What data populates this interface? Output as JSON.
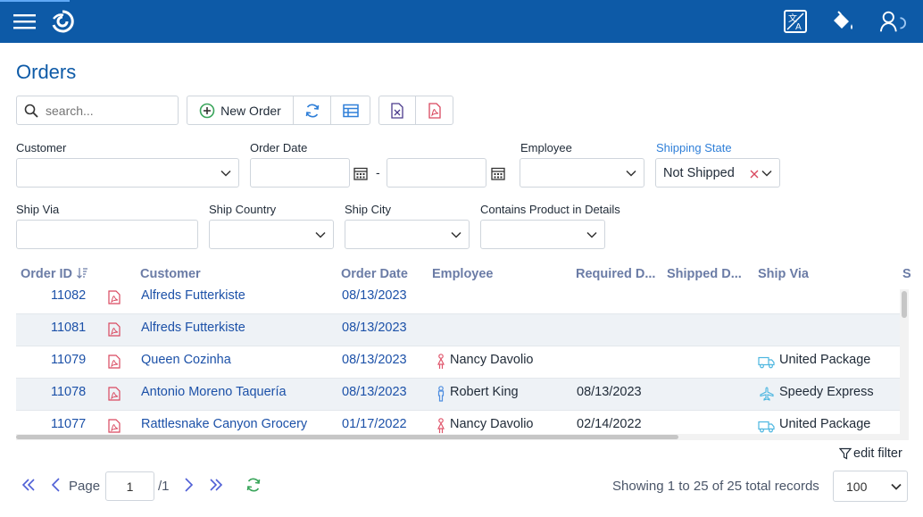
{
  "page": {
    "title": "Orders"
  },
  "toolbar": {
    "search_placeholder": "search...",
    "new_order_label": "New Order"
  },
  "filters": {
    "customer": {
      "label": "Customer",
      "value": ""
    },
    "order_date": {
      "label": "Order Date",
      "separator": "-"
    },
    "employee": {
      "label": "Employee",
      "value": ""
    },
    "shipping_state": {
      "label": "Shipping State",
      "value": "Not Shipped"
    },
    "ship_via": {
      "label": "Ship Via",
      "value": ""
    },
    "ship_country": {
      "label": "Ship Country",
      "value": ""
    },
    "ship_city": {
      "label": "Ship City",
      "value": ""
    },
    "contains_product": {
      "label": "Contains Product in Details",
      "value": ""
    }
  },
  "grid": {
    "columns": [
      "Order ID",
      "Customer",
      "Order Date",
      "Employee",
      "Required D...",
      "Shipped D...",
      "Ship Via",
      "S"
    ],
    "rows": [
      {
        "order_id": "11082",
        "customer": "Alfreds Futterkiste",
        "order_date": "08/13/2023",
        "employee": "",
        "employee_gender": "",
        "required": "",
        "shipped": "",
        "ship_via": "",
        "ship_icon": ""
      },
      {
        "order_id": "11081",
        "customer": "Alfreds Futterkiste",
        "order_date": "08/13/2023",
        "employee": "",
        "employee_gender": "",
        "required": "",
        "shipped": "",
        "ship_via": "",
        "ship_icon": ""
      },
      {
        "order_id": "11079",
        "customer": "Queen Cozinha",
        "order_date": "08/13/2023",
        "employee": "Nancy Davolio",
        "employee_gender": "female",
        "required": "",
        "shipped": "",
        "ship_via": "United Package",
        "ship_icon": "truck"
      },
      {
        "order_id": "11078",
        "customer": "Antonio Moreno Taquería",
        "order_date": "08/13/2023",
        "employee": "Robert King",
        "employee_gender": "male",
        "required": "08/13/2023",
        "shipped": "",
        "ship_via": "Speedy Express",
        "ship_icon": "plane"
      },
      {
        "order_id": "11077",
        "customer": "Rattlesnake Canyon Grocery",
        "order_date": "01/17/2022",
        "employee": "Nancy Davolio",
        "employee_gender": "female",
        "required": "02/14/2022",
        "shipped": "",
        "ship_via": "United Package",
        "ship_icon": "truck"
      }
    ]
  },
  "footer": {
    "edit_filter_label": "edit filter",
    "page_label": "Page",
    "page_value": "1",
    "page_total": "/1",
    "summary": "Showing 1 to 25 of 25 total records",
    "page_size": "100"
  },
  "colors": {
    "header_bg": "#0d5aa7",
    "title": "#0d5aa7",
    "link": "#1c51a8",
    "accent_icon": "#2f7fd8",
    "pdf_icon": "#d9485f",
    "female_icon": "#e0566c",
    "male_icon": "#4f8ee0",
    "ship_icon": "#4cb6e0",
    "pager": "#4f5fd6",
    "refresh_green": "#3aa55b"
  }
}
